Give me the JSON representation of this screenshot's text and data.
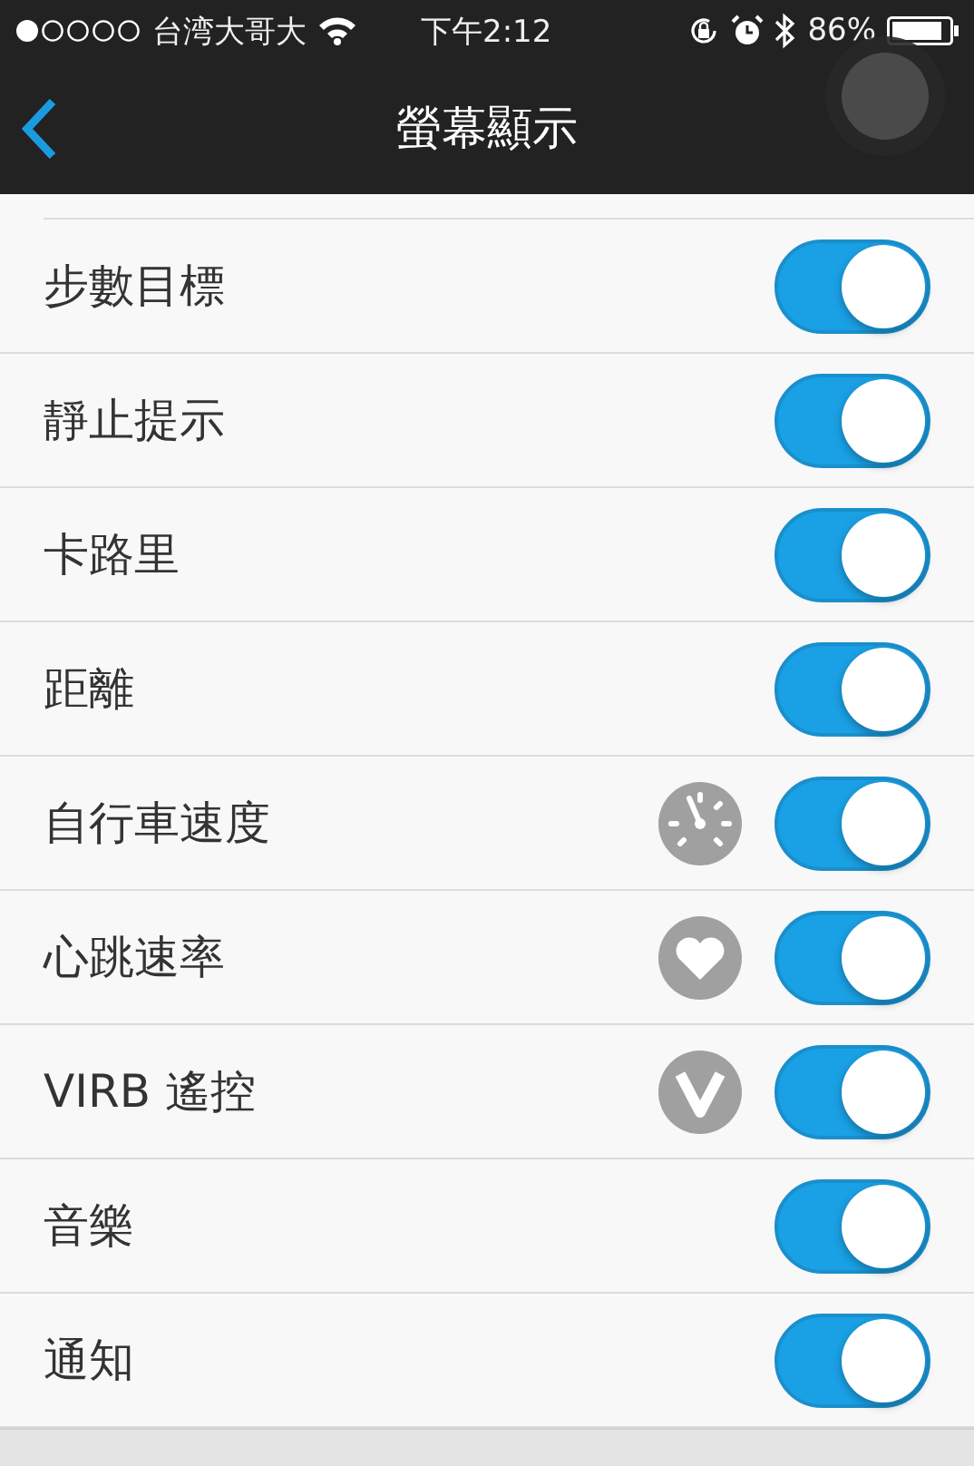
{
  "status_bar": {
    "carrier": "台湾大哥大",
    "time": "下午2:12",
    "battery": "86%"
  },
  "nav": {
    "title": "螢幕顯示"
  },
  "rows": [
    {
      "kind": "plain",
      "label": "步數目標",
      "on": true
    },
    {
      "kind": "plain",
      "label": "靜止提示",
      "on": true
    },
    {
      "kind": "plain",
      "label": "卡路里",
      "on": true
    },
    {
      "kind": "plain",
      "label": "距離",
      "on": true
    },
    {
      "kind": "gauge",
      "label": "自行車速度",
      "on": true
    },
    {
      "kind": "heart",
      "label": "心跳速率",
      "on": true
    },
    {
      "kind": "vlogo",
      "label": "VIRB 遙控",
      "on": true
    },
    {
      "kind": "plain",
      "label": "音樂",
      "on": true
    },
    {
      "kind": "plain",
      "label": "通知",
      "on": true
    }
  ]
}
